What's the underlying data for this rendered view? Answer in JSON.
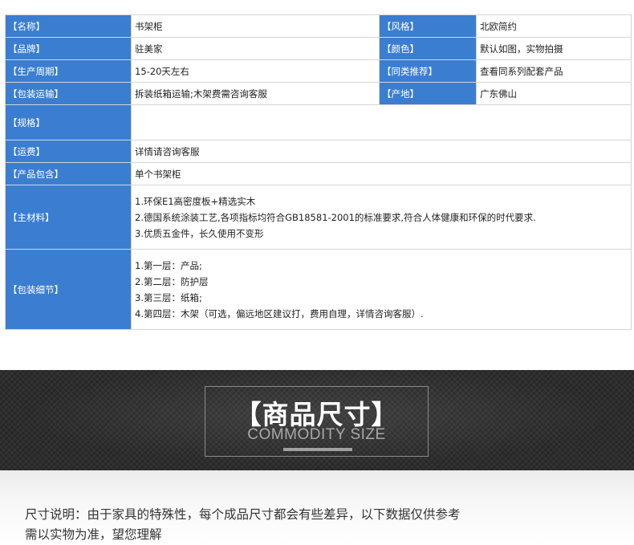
{
  "spec": {
    "name_label": "【名称】",
    "name_value": "书架柜",
    "style_label": "【风格】",
    "style_value": "北欧简约",
    "brand_label": "【品牌】",
    "brand_value": "驻美家",
    "color_label": "【颜色】",
    "color_value": "默认如图，实物拍摄",
    "cycle_label": "【生产周期】",
    "cycle_value": "15-20天左右",
    "similar_label": "【同类推荐】",
    "similar_value": "查看同系列配套产品",
    "shipping_label": "【包装运输】",
    "shipping_value": "拆装纸箱运输;木架费需咨询客服",
    "origin_label": "【产地】",
    "origin_value": "广东佛山",
    "size_label": "【规格】",
    "size_value": "",
    "freight_label": "【运费】",
    "freight_value": "详情请咨询客服",
    "includes_label": "【产品包含】",
    "includes_value": "单个书架柜",
    "material_label": "【主材料】",
    "material_lines": [
      "1.环保E1高密度板+精选实木",
      "2.德国系统涂装工艺,各项指标均符合GB18581-2001的标准要求,符合人体健康和环保的时代要求.",
      "3.优质五金件，长久使用不变形"
    ],
    "packing_label": "【包装细节】",
    "packing_lines": [
      "1.第一层：产品;",
      "2.第二层：防护层",
      "3.第三层：纸箱;",
      "4.第四层：木架（可选，偏远地区建议打，费用自理，详情咨询客服）."
    ]
  },
  "banner": {
    "title": "【商品尺寸】",
    "subtitle": "COMMODITY SIZE"
  },
  "note": {
    "line1": "尺寸说明：由于家具的特殊性，每个成品尺寸都会有些差异，以下数据仅供参考",
    "line2": "需以实物为准，望您理解"
  },
  "colors": {
    "label_bg": "#3b7ed1",
    "banner_bg": "#2d2d2d"
  }
}
